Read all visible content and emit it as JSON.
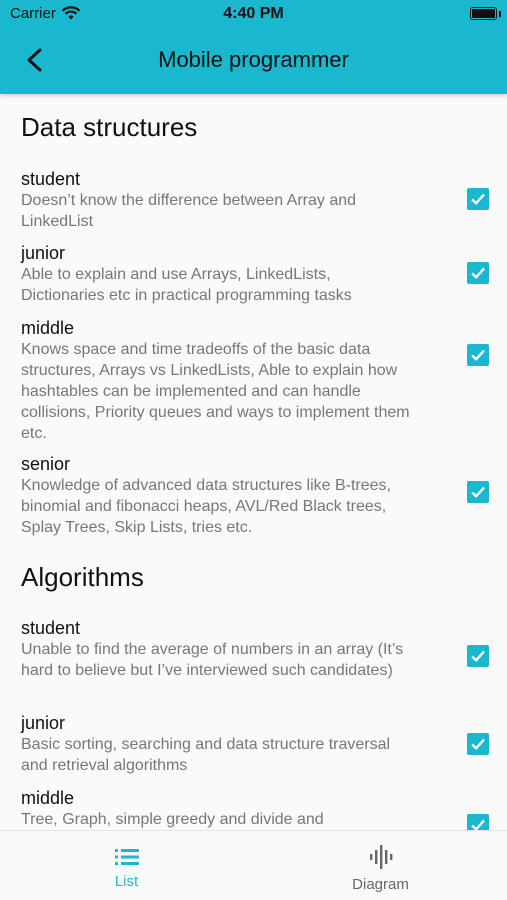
{
  "status_bar": {
    "carrier": "Carrier",
    "time": "4:40 PM"
  },
  "header": {
    "title": "Mobile programmer"
  },
  "sections": [
    {
      "title": "Data structures",
      "items": [
        {
          "level": "student",
          "description": "Doesn’t know the difference between Array and LinkedList",
          "checked": true
        },
        {
          "level": "junior",
          "description": "Able to explain and use Arrays, LinkedLists, Dictionaries etc in practical programming tasks",
          "checked": true
        },
        {
          "level": "middle",
          "description": "Knows space and time tradeoffs of the basic data structures, Arrays vs LinkedLists, Able to explain how hashtables can be implemented and can handle collisions, Priority queues and ways to implement them etc.",
          "checked": true
        },
        {
          "level": "senior",
          "description": "Knowledge of advanced data structures like B-trees, binomial and fibonacci heaps, AVL/Red Black trees, Splay Trees, Skip Lists, tries etc.",
          "checked": true
        }
      ]
    },
    {
      "title": "Algorithms",
      "items": [
        {
          "level": "student",
          "description": "Unable to find the average of numbers in an array (It’s hard to believe but I’ve interviewed such candidates)",
          "checked": true
        },
        {
          "level": "junior",
          "description": "Basic sorting, searching and data structure traversal and retrieval algorithms",
          "checked": true
        },
        {
          "level": "middle",
          "description": "Tree, Graph, simple greedy and divide and",
          "checked": true
        }
      ]
    }
  ],
  "bottom_nav": {
    "list_label": "List",
    "diagram_label": "Diagram",
    "active": "List"
  },
  "colors": {
    "accent": "#1ab8cf"
  }
}
